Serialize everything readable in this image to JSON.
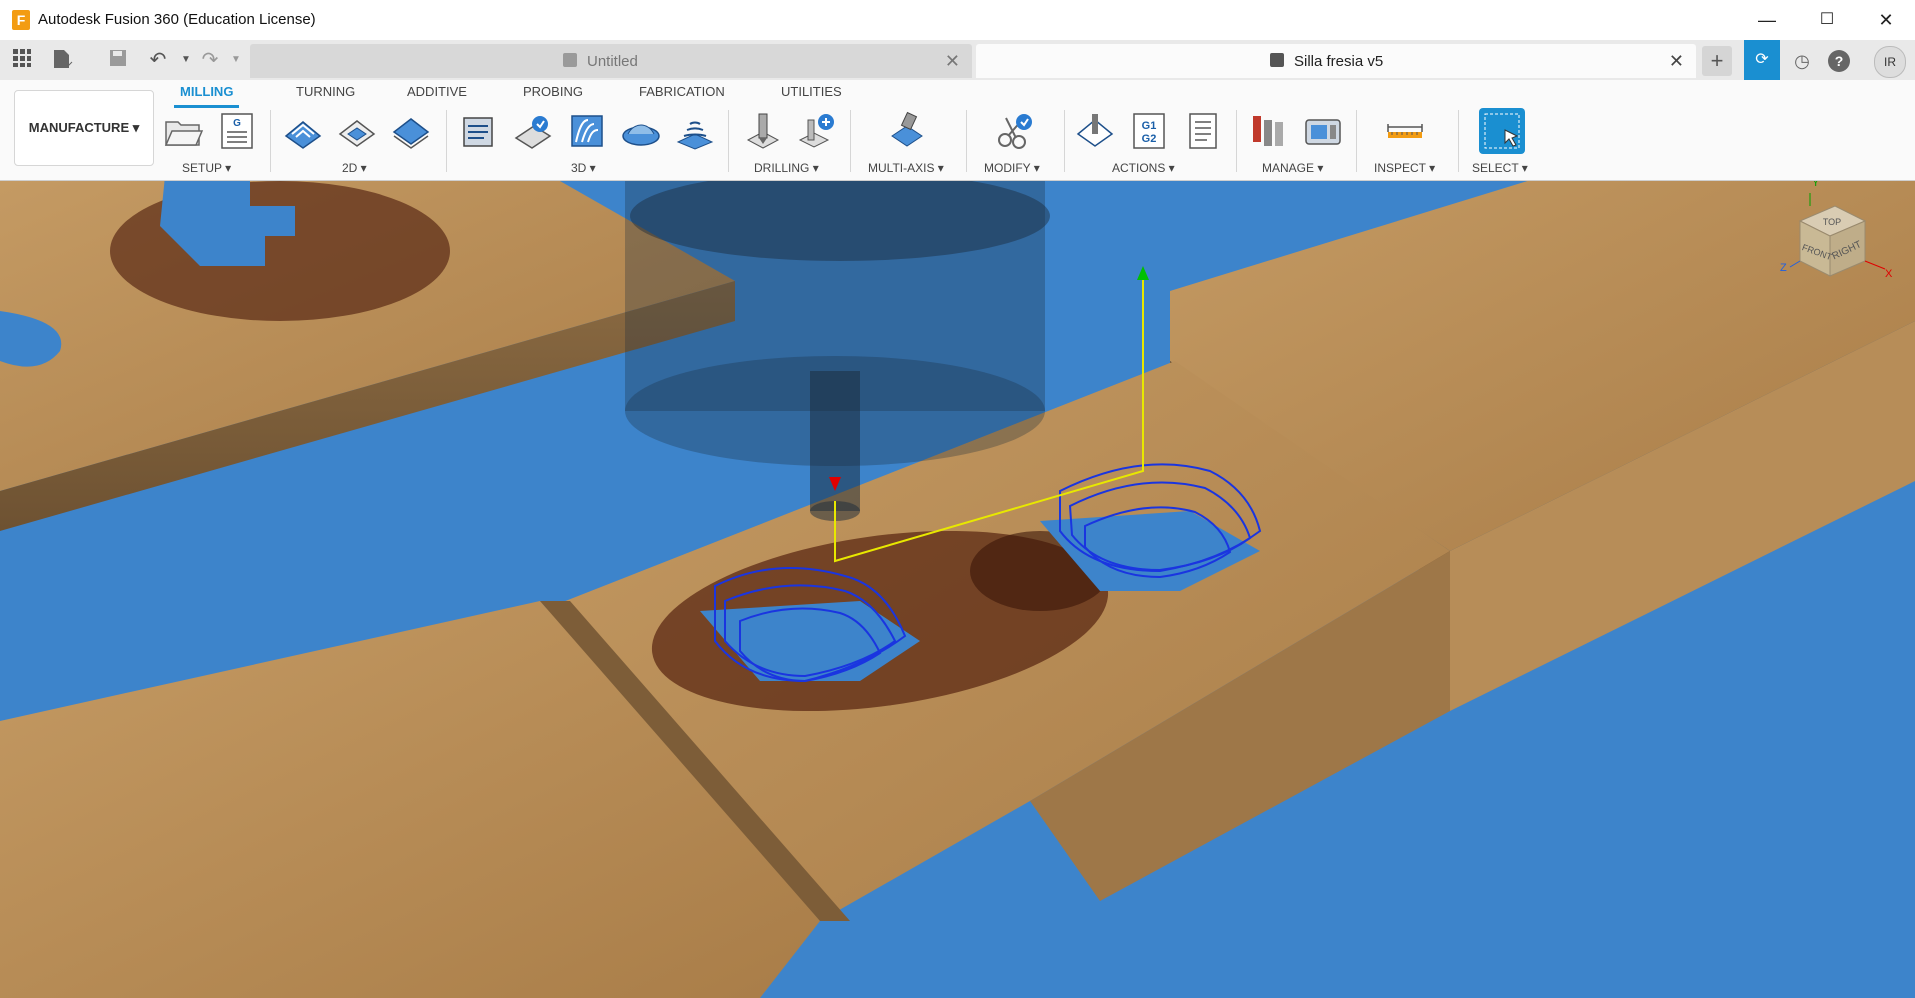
{
  "window": {
    "title": "Autodesk Fusion 360 (Education License)",
    "controls": {
      "minimize": "—",
      "maximize": "☐",
      "close": "✕"
    }
  },
  "tabs": [
    {
      "label": "Untitled",
      "active": false
    },
    {
      "label": "Silla fresia v5",
      "active": true
    }
  ],
  "tabbar": {
    "user_initials": "IR",
    "icons": [
      "grid-icon",
      "file-icon",
      "save-icon",
      "undo-icon",
      "redo-icon",
      "new-tab-icon",
      "job-status-icon",
      "clock-icon",
      "help-icon"
    ]
  },
  "ribbon": {
    "workspace": "MANUFACTURE",
    "tabs": [
      "MILLING",
      "TURNING",
      "ADDITIVE",
      "PROBING",
      "FABRICATION",
      "UTILITIES"
    ],
    "active_tab": "MILLING",
    "groups": [
      "SETUP",
      "2D",
      "3D",
      "DRILLING",
      "MULTI-AXIS",
      "MODIFY",
      "ACTIONS",
      "MANAGE",
      "INSPECT",
      "SELECT"
    ],
    "actions_g_code": [
      "G1",
      "G2"
    ],
    "setup_g": "G"
  },
  "viewcube": {
    "top": "TOP",
    "front": "FRONT",
    "right": "RIGHT",
    "axis_x": "X",
    "axis_y": "Y",
    "axis_z": "Z"
  },
  "colors": {
    "accent": "#1a8fd1",
    "viewport_bg": "#3b80c8",
    "wood": "#b48a57",
    "toolpath": "#1a35e0"
  }
}
